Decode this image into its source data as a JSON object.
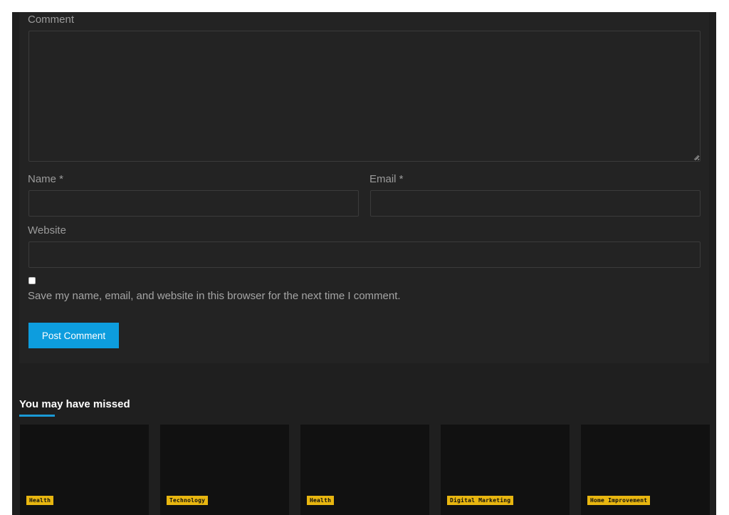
{
  "comment_form": {
    "comment_label": "Comment",
    "comment_value": "",
    "name_label": "Name *",
    "name_value": "",
    "email_label": "Email *",
    "email_value": "",
    "website_label": "Website",
    "website_value": "",
    "save_info_checked": false,
    "save_info_label": "Save my name, email, and website in this browser for the next time I comment.",
    "submit_label": "Post Comment"
  },
  "missed_section": {
    "title": "You may have missed",
    "posts": [
      {
        "category": "Health"
      },
      {
        "category": "Technology"
      },
      {
        "category": "Health"
      },
      {
        "category": "Digital Marketing"
      },
      {
        "category": "Home Improvement"
      }
    ]
  },
  "colors": {
    "page_background": "#1f1f1f",
    "card_background": "#232323",
    "accent": "#0d9dde",
    "badge": "#e8b610"
  }
}
